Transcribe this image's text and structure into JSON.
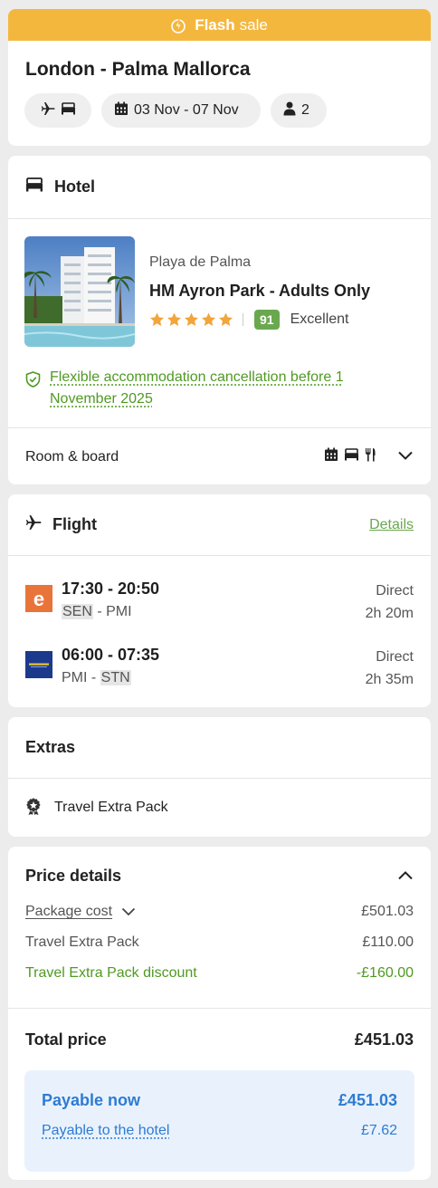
{
  "colors": {
    "flash_bg": "#f4b73e",
    "green": "#4f9a22",
    "score_green": "#6aa84f",
    "blue": "#2e7bd3",
    "pay_bg": "#e9f2fc",
    "star": "#f2a53a"
  },
  "summary": {
    "flash_label_bold": "Flash",
    "flash_label": "sale",
    "title": "London - Palma Mallorca",
    "chip_type_icons": [
      "plane-icon",
      "bed-icon"
    ],
    "dates": "03 Nov - 07 Nov",
    "travellers": "2"
  },
  "hotel": {
    "section_title": "Hotel",
    "area": "Playa de Palma",
    "name": "HM Ayron Park - Adults Only",
    "stars": 5,
    "score": "91",
    "score_label": "Excellent",
    "cancellation": "Flexible accommodation cancellation before 1 November 2025",
    "room_board_label": "Room & board",
    "room_board_icons": [
      "calendar-icon",
      "bed-icon",
      "fork-knife-icon"
    ]
  },
  "flight": {
    "section_title": "Flight",
    "details_link": "Details",
    "legs": [
      {
        "airline_icon": "easyjet-logo",
        "times": "17:30 - 20:50",
        "from": "SEN",
        "to": "PMI",
        "stops": "Direct",
        "duration": "2h 20m"
      },
      {
        "airline_icon": "ryanair-logo",
        "times": "06:00 - 07:35",
        "from": "PMI",
        "to": "STN",
        "stops": "Direct",
        "duration": "2h 35m"
      }
    ]
  },
  "extras": {
    "section_title": "Extras",
    "item": "Travel Extra Pack"
  },
  "price": {
    "section_title": "Price details",
    "package_cost_label": "Package cost",
    "package_cost": "£501.03",
    "extra_pack_label": "Travel Extra Pack",
    "extra_pack": "£110.00",
    "discount_label": "Travel Extra Pack discount",
    "discount": "-£160.00",
    "total_label": "Total price",
    "total": "£451.03",
    "payable_now_label": "Payable now",
    "payable_now": "£451.03",
    "payable_hotel_label": "Payable to the hotel",
    "payable_hotel": "£7.62"
  }
}
